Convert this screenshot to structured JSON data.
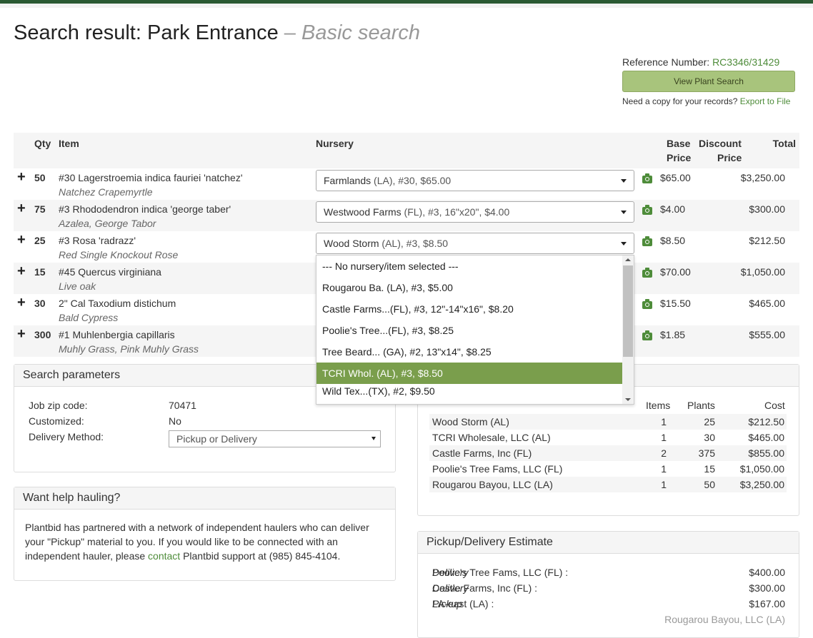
{
  "title": {
    "main": "Search result: Park Entrance",
    "sep": "–",
    "sub": "Basic search"
  },
  "reference": {
    "label": "Reference Number:",
    "value": "RC3346/31429"
  },
  "view_button": "View Plant Search",
  "copy": {
    "text": "Need a copy for your records?",
    "link": "Export to File"
  },
  "table": {
    "headers": {
      "qty": "Qty",
      "item": "Item",
      "nursery": "Nursery",
      "base1": "Base",
      "base2": "Price",
      "disc1": "Discount",
      "disc2": "Price",
      "total": "Total"
    },
    "rows": [
      {
        "plus": "+",
        "qty": "50",
        "item": "#30 Lagerstroemia indica fauriei 'natchez'",
        "common": "Natchez Crapemyrtle",
        "nursery_main": "Farmlands",
        "nursery_detail": " (LA), #30, $65.00",
        "base": "$65.00",
        "total": "$3,250.00"
      },
      {
        "plus": "+",
        "qty": "75",
        "item": "#3 Rhododendron indica 'george taber'",
        "common": "Azalea, George Tabor",
        "nursery_main": "Westwood Farms",
        "nursery_detail": " (FL), #3, 16\"x20\", $4.00",
        "base": "$4.00",
        "total": "$300.00"
      },
      {
        "plus": "+",
        "qty": "25",
        "item": "#3 Rosa 'radrazz'",
        "common": "Red Single Knockout Rose",
        "nursery_main": "Wood Storm",
        "nursery_detail": " (AL), #3, $8.50",
        "base": "$8.50",
        "total": "$212.50"
      },
      {
        "plus": "+",
        "qty": "15",
        "item": "#45 Quercus virginiana",
        "common": "Live oak",
        "nursery_main": "",
        "nursery_detail": "",
        "base": "$70.00",
        "total": "$1,050.00"
      },
      {
        "plus": "+",
        "qty": "30",
        "item": "2\" Cal Taxodium distichum",
        "common": "Bald Cypress",
        "nursery_main": "",
        "nursery_detail": "",
        "base": "$15.50",
        "total": "$465.00"
      },
      {
        "plus": "+",
        "qty": "300",
        "item": "#1 Muhlenbergia capillaris",
        "common": "Muhly Grass, Pink Muhly Grass",
        "nursery_main": "",
        "nursery_detail": "",
        "base": "$1.85",
        "total": "$555.00"
      }
    ]
  },
  "dropdown": {
    "options": [
      {
        "main": "--- No nursery/item selected ---",
        "detail": ""
      },
      {
        "main": "Rougarou Ba.",
        "detail": " (LA), #3, $5.00"
      },
      {
        "main": "Castle Farms...",
        "detail": "(FL), #3, 12\"-14\"x16\", $8.20"
      },
      {
        "main": "Poolie's Tree...",
        "detail": "(FL), #3, $8.25"
      },
      {
        "main": "Tree Beard...",
        "detail": " (GA), #2, 13\"x14\", $8.25"
      },
      {
        "main": "TCRI Whol.",
        "detail": " (AL), #3, $8.50"
      },
      {
        "main": "Wild Tex...",
        "detail": "(TX), #2, $9.50"
      }
    ],
    "selected_index": 5
  },
  "search_params": {
    "title": "Search parameters",
    "zip_label": "Job zip code:",
    "zip": "70471",
    "custom_label": "Customized:",
    "custom": "No",
    "delivery_label": "Delivery Method:",
    "delivery": "Pickup or Delivery"
  },
  "help": {
    "title": "Want help hauling?",
    "text1": "Plantbid has partnered with a network of independent haulers who can deliver your \"Pickup\" material to you. If you would like to be connected with an independent hauler, please ",
    "link": "contact",
    "text2": " Plantbid support at (985) 845-4104."
  },
  "summary": {
    "headers": {
      "items": "Items",
      "plants": "Plants",
      "cost": "Cost"
    },
    "rows": [
      {
        "name": "Wood Storm (AL)",
        "items": "1",
        "plants": "25",
        "cost": "$212.50"
      },
      {
        "name": "TCRI Wholesale, LLC  (AL)",
        "items": "1",
        "plants": "30",
        "cost": "$465.00"
      },
      {
        "name": "Castle Farms, Inc (FL)",
        "items": "2",
        "plants": "375",
        "cost": "$855.00"
      },
      {
        "name": "Poolie's Tree Fams, LLC (FL)",
        "items": "1",
        "plants": "15",
        "cost": "$1,050.00"
      },
      {
        "name": "Rougarou Bayou, LLC (LA)",
        "items": "1",
        "plants": "50",
        "cost": "$3,250.00"
      }
    ]
  },
  "estimate": {
    "title": "Pickup/Delivery Estimate",
    "rows": [
      {
        "name": "Poolie's Tree Fams, LLC (FL) : ",
        "mode": "Delivery",
        "cost": "$400.00"
      },
      {
        "name": "Castle Farms, Inc (FL) : ",
        "mode": "Delivery",
        "cost": "$300.00"
      },
      {
        "name": "LA-east (LA) : ",
        "mode": "Pickup",
        "cost": "$167.00"
      }
    ],
    "footer": "Rougarou Bayou, LLC (LA)"
  },
  "colors": {
    "brand_green": "#4e8c3a",
    "button": "#a8c47c",
    "selected": "#7a9e4c",
    "topbar": "#2a5a33"
  }
}
